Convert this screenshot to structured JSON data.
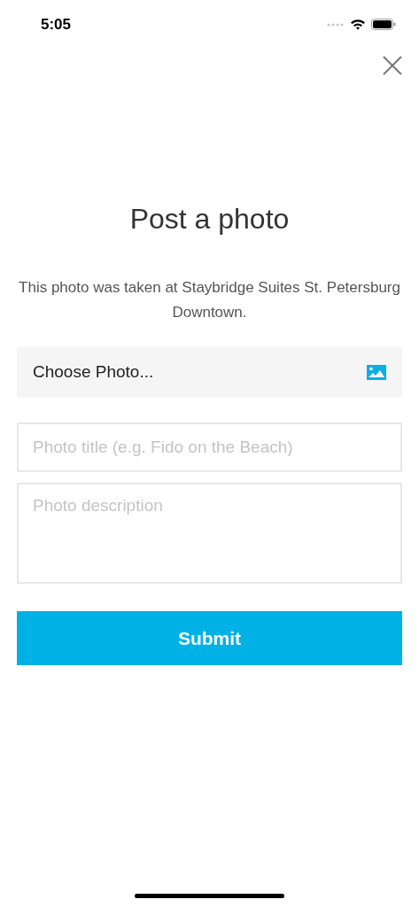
{
  "status_bar": {
    "time": "5:05"
  },
  "title": "Post a photo",
  "description": "This photo was taken at Staybridge Suites St. Petersburg Downtown.",
  "photo_picker": {
    "label": "Choose Photo..."
  },
  "fields": [
    {
      "kind": "line",
      "placeholder": "Photo title (e.g. Fido on the Beach)"
    },
    {
      "kind": "area",
      "placeholder": "Photo description"
    }
  ],
  "submit": "Submit"
}
